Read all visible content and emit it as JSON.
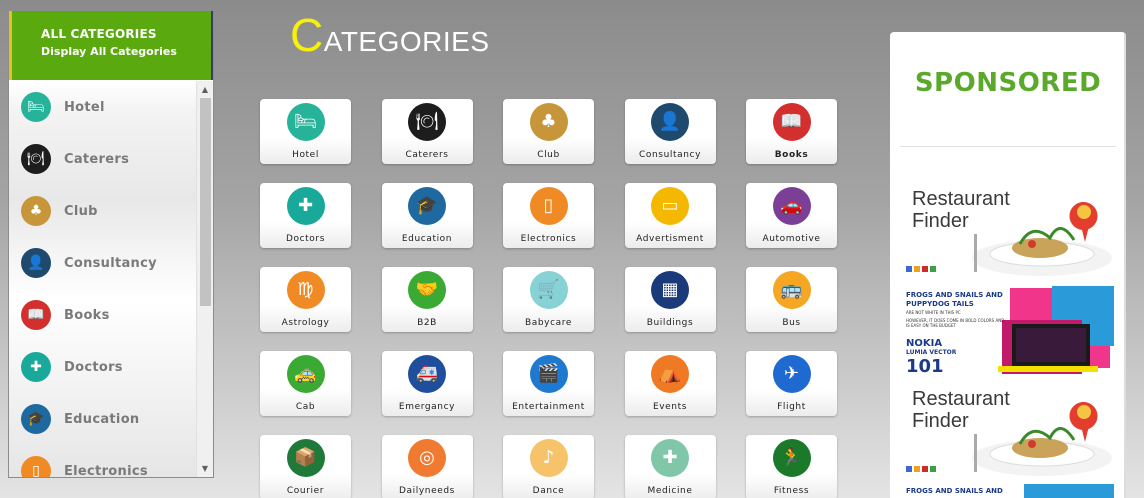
{
  "sidebar": {
    "header_title": "ALL CATEGORIES",
    "header_subtitle": "Display All Categories",
    "items": [
      {
        "label": "Hotel",
        "icon": "hotel-icon",
        "color": "#26b39a"
      },
      {
        "label": "Caterers",
        "icon": "cloche-icon",
        "color": "#1d1d1d"
      },
      {
        "label": "Club",
        "icon": "club-icon",
        "color": "#c8963a"
      },
      {
        "label": "Consultancy",
        "icon": "consultant-icon",
        "color": "#1f4a6e"
      },
      {
        "label": "Books",
        "icon": "book-icon",
        "color": "#d32f2f"
      },
      {
        "label": "Doctors",
        "icon": "medical-kit-icon",
        "color": "#18a99a"
      },
      {
        "label": "Education",
        "icon": "graduation-cap-icon",
        "color": "#1e6aa0"
      },
      {
        "label": "Electronics",
        "icon": "phone-icon",
        "color": "#f08a24"
      }
    ],
    "scroll_up": "▲",
    "scroll_down": "▼"
  },
  "page": {
    "title_first_letter": "C",
    "title_rest": "ATEGORIES"
  },
  "categories": [
    {
      "label": "Hotel",
      "icon": "hotel-icon",
      "color": "#26b39a"
    },
    {
      "label": "Caterers",
      "icon": "cloche-icon",
      "color": "#1d1d1d"
    },
    {
      "label": "Club",
      "icon": "club-icon",
      "color": "#c8963a"
    },
    {
      "label": "Consultancy",
      "icon": "consultant-icon",
      "color": "#1f4a6e"
    },
    {
      "label": "Books",
      "icon": "book-icon",
      "color": "#d32f2f",
      "bold": true
    },
    {
      "label": "Doctors",
      "icon": "medical-kit-icon",
      "color": "#18a99a"
    },
    {
      "label": "Education",
      "icon": "graduation-cap-icon",
      "color": "#1e6aa0"
    },
    {
      "label": "Electronics",
      "icon": "phone-icon",
      "color": "#f08a24"
    },
    {
      "label": "Advertisment",
      "icon": "monitor-icon",
      "color": "#f5b800"
    },
    {
      "label": "Automotive",
      "icon": "car-icon",
      "color": "#7b3f98"
    },
    {
      "label": "Astrology",
      "icon": "zodiac-icon",
      "color": "#f08a24"
    },
    {
      "label": "B2B",
      "icon": "handshake-icon",
      "color": "#3aaa35"
    },
    {
      "label": "Babycare",
      "icon": "cart-icon",
      "color": "#86d2d4"
    },
    {
      "label": "Buildings",
      "icon": "building-icon",
      "color": "#1b3a7a"
    },
    {
      "label": "Bus",
      "icon": "bus-icon",
      "color": "#f5a623"
    },
    {
      "label": "Cab",
      "icon": "taxi-icon",
      "color": "#3aaa35"
    },
    {
      "label": "Emergancy",
      "icon": "ambulance-icon",
      "color": "#1e4e9c"
    },
    {
      "label": "Entertainment",
      "icon": "clapperboard-icon",
      "color": "#1e7ad0"
    },
    {
      "label": "Events",
      "icon": "tent-icon",
      "color": "#f07a24"
    },
    {
      "label": "Flight",
      "icon": "airplane-icon",
      "color": "#1e6ad0"
    },
    {
      "label": "Courier",
      "icon": "courier-icon",
      "color": "#1f7a3a"
    },
    {
      "label": "Dailyneeds",
      "icon": "coins-icon",
      "color": "#f07a30"
    },
    {
      "label": "Dance",
      "icon": "dancer-icon",
      "color": "#f6c26a"
    },
    {
      "label": "Medicine",
      "icon": "first-aid-icon",
      "color": "#7fc7a8"
    },
    {
      "label": "Fitness",
      "icon": "runner-icon",
      "color": "#1a7a2a"
    }
  ],
  "sponsored": {
    "title": "SPONSORED",
    "ads": [
      {
        "type": "restaurant",
        "line1": "Restaurant",
        "line2": "Finder"
      },
      {
        "type": "nokia",
        "headline": "FROGS AND SNAILS AND PUPPYDOG TAILS",
        "sub": "ARE NOT WHITE IN THIS PC",
        "body": "HOWEVER, IT DOES COME IN BOLD COLORS AND IS EASY ON THE BUDGET",
        "brand": "NOKIA",
        "model": "LUMIA VECTOR",
        "number": "101"
      },
      {
        "type": "restaurant",
        "line1": "Restaurant",
        "line2": "Finder"
      },
      {
        "type": "nokia-partial",
        "headline": "FROGS AND SNAILS AND"
      }
    ]
  }
}
